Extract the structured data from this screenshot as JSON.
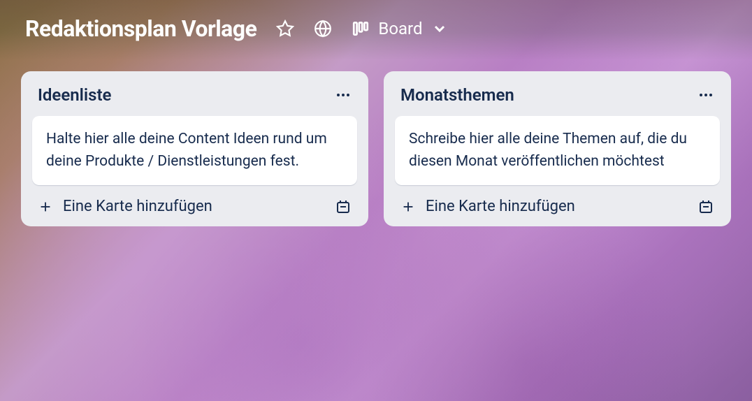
{
  "header": {
    "title": "Redaktionsplan Vorlage",
    "view_label": "Board"
  },
  "lists": [
    {
      "title": "Ideenliste",
      "cards": [
        {
          "text": "Halte hier alle deine Content Ideen rund um deine Produkte / Dienstleistungen fest."
        }
      ],
      "add_label": "Eine Karte hinzufügen"
    },
    {
      "title": "Monatsthemen",
      "cards": [
        {
          "text": "Schreibe hier alle deine Themen auf, die du diesen Monat veröffentlichen möchtest"
        }
      ],
      "add_label": "Eine Karte hinzufügen"
    }
  ]
}
